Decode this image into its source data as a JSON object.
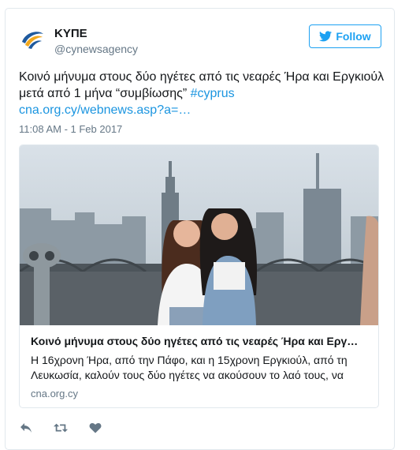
{
  "account": {
    "name": "ΚΥΠΕ",
    "handle": "@cynewsagency",
    "follow_label": "Follow"
  },
  "tweet": {
    "text": "Κοινό μήνυμα στους δύο ηγέτες από τις νεαρές Ήρα και Εργκιούλ μετά από 1 μήνα “συμβίωσης”",
    "hashtag": "#cyprus",
    "link": "cna.org.cy/webnews.asp?a=…",
    "timestamp": "11:08 AM - 1 Feb 2017"
  },
  "card": {
    "title": "Κοινό μήνυμα στους δύο ηγέτες από τις νεαρές Ήρα και Εργ…",
    "description": "Η 16χρονη Ήρα, από την Πάφο, και η 15χρονη Εργκιούλ, από τη Λευκωσία, καλούν τους δύο ηγέτες να ακούσουν το λαό τους, να",
    "domain": "cna.org.cy"
  },
  "actions": [
    "reply-icon",
    "retweet-icon",
    "like-icon"
  ],
  "colors": {
    "accent": "#1da1f2",
    "link": "#1b95e0",
    "muted": "#657786",
    "border": "#e1e8ed"
  }
}
